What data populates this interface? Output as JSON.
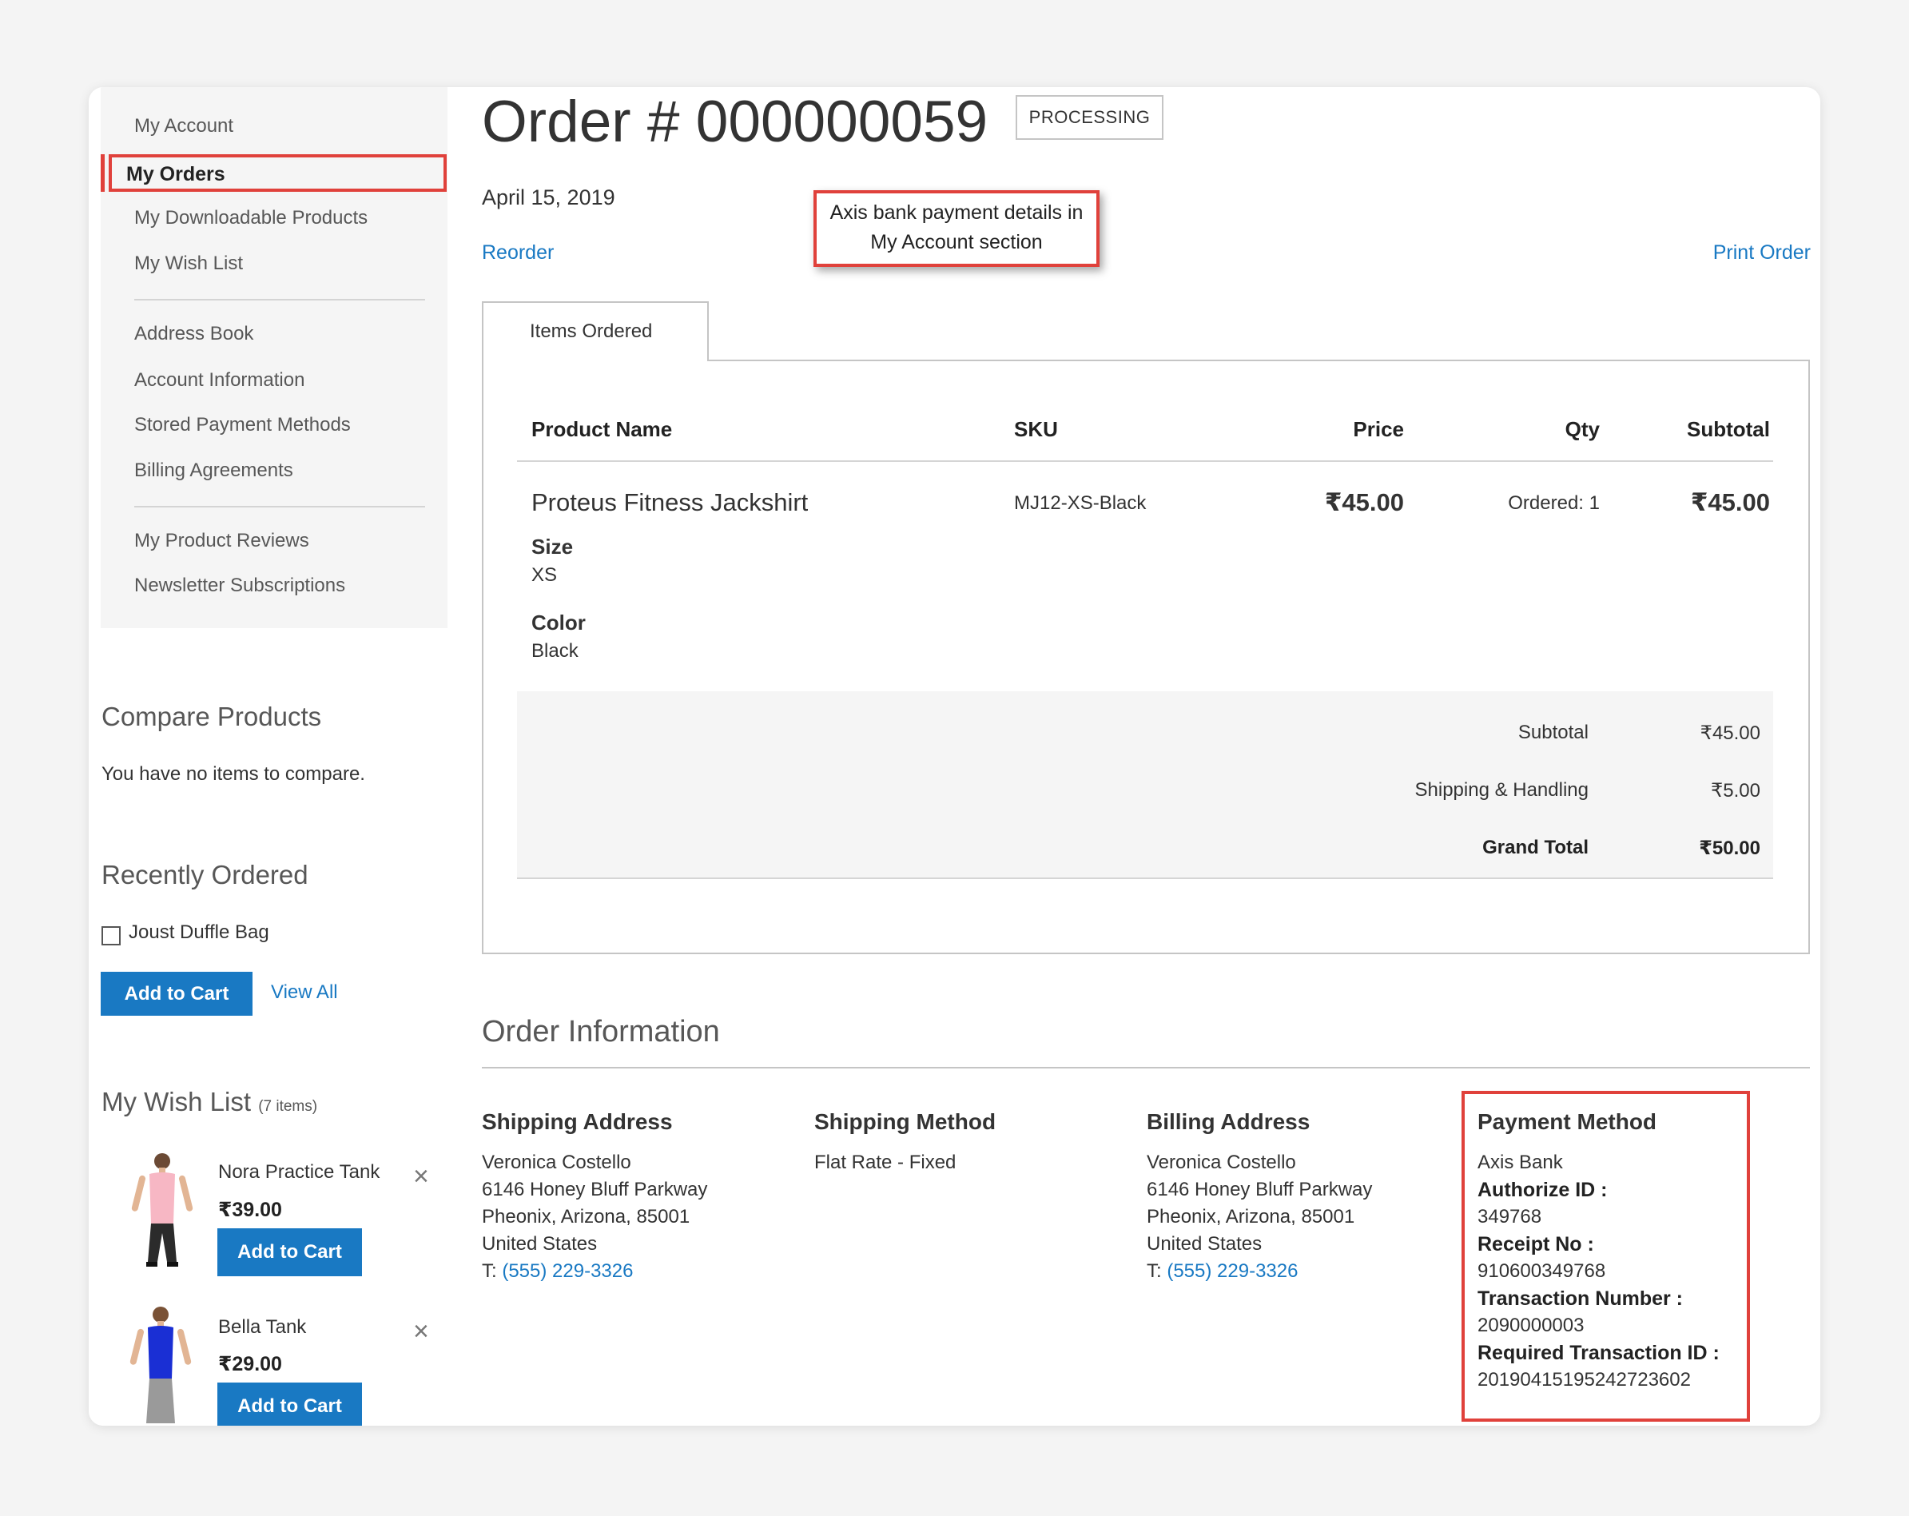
{
  "sidebar": {
    "nav": [
      "My Account",
      "My Orders",
      "My Downloadable Products",
      "My Wish List",
      "Address Book",
      "Account Information",
      "Stored Payment Methods",
      "Billing Agreements",
      "My Product Reviews",
      "Newsletter Subscriptions"
    ],
    "compare": {
      "title": "Compare Products",
      "empty": "You have no items to compare."
    },
    "recent": {
      "title": "Recently Ordered",
      "item": "Joust Duffle Bag",
      "add_to_cart": "Add to Cart",
      "view_all": "View All"
    },
    "wishlist": {
      "title": "My Wish List",
      "count": "(7 items)",
      "items": [
        {
          "name": "Nora Practice Tank",
          "price": "₹39.00",
          "add_to_cart": "Add to Cart",
          "color": "#f7b7c4"
        },
        {
          "name": "Bella Tank",
          "price": "₹29.00",
          "add_to_cart": "Add to Cart",
          "color": "#1a2fd4"
        }
      ]
    }
  },
  "order": {
    "title": "Order # 000000059",
    "status": "PROCESSING",
    "date": "April 15, 2019",
    "reorder": "Reorder",
    "print": "Print Order",
    "annotation": "Axis bank payment details in My Account section",
    "tab": "Items Ordered",
    "columns": {
      "name": "Product Name",
      "sku": "SKU",
      "price": "Price",
      "qty": "Qty",
      "subtotal": "Subtotal"
    },
    "item": {
      "name": "Proteus Fitness Jackshirt",
      "sku": "MJ12-XS-Black",
      "price": "₹45.00",
      "qty": "Ordered: 1",
      "subtotal": "₹45.00",
      "options": [
        {
          "label": "Size",
          "value": "XS"
        },
        {
          "label": "Color",
          "value": "Black"
        }
      ]
    },
    "totals": [
      {
        "label": "Subtotal",
        "value": "₹45.00"
      },
      {
        "label": "Shipping & Handling",
        "value": "₹5.00"
      },
      {
        "label": "Grand Total",
        "value": "₹50.00"
      }
    ]
  },
  "info": {
    "title": "Order Information",
    "shipping_address": {
      "title": "Shipping Address",
      "lines": [
        "Veronica Costello",
        "6146 Honey Bluff Parkway",
        "Pheonix, Arizona, 85001",
        "United States"
      ],
      "phone_prefix": "T:",
      "phone": "(555) 229-3326"
    },
    "shipping_method": {
      "title": "Shipping Method",
      "value": "Flat Rate - Fixed"
    },
    "billing_address": {
      "title": "Billing Address",
      "lines": [
        "Veronica Costello",
        "6146 Honey Bluff Parkway",
        "Pheonix, Arizona, 85001",
        "United States"
      ],
      "phone_prefix": "T:",
      "phone": "(555) 229-3326"
    },
    "payment": {
      "title": "Payment Method",
      "bank": "Axis Bank",
      "fields": [
        {
          "label": "Authorize ID :",
          "value": "349768"
        },
        {
          "label": "Receipt No :",
          "value": "910600349768"
        },
        {
          "label": "Transaction Number :",
          "value": "2090000003"
        },
        {
          "label": "Required Transaction ID :",
          "value": "20190415195242723602"
        }
      ]
    }
  },
  "colors": {
    "accent": "#1979c3",
    "highlight": "#e0413b"
  }
}
